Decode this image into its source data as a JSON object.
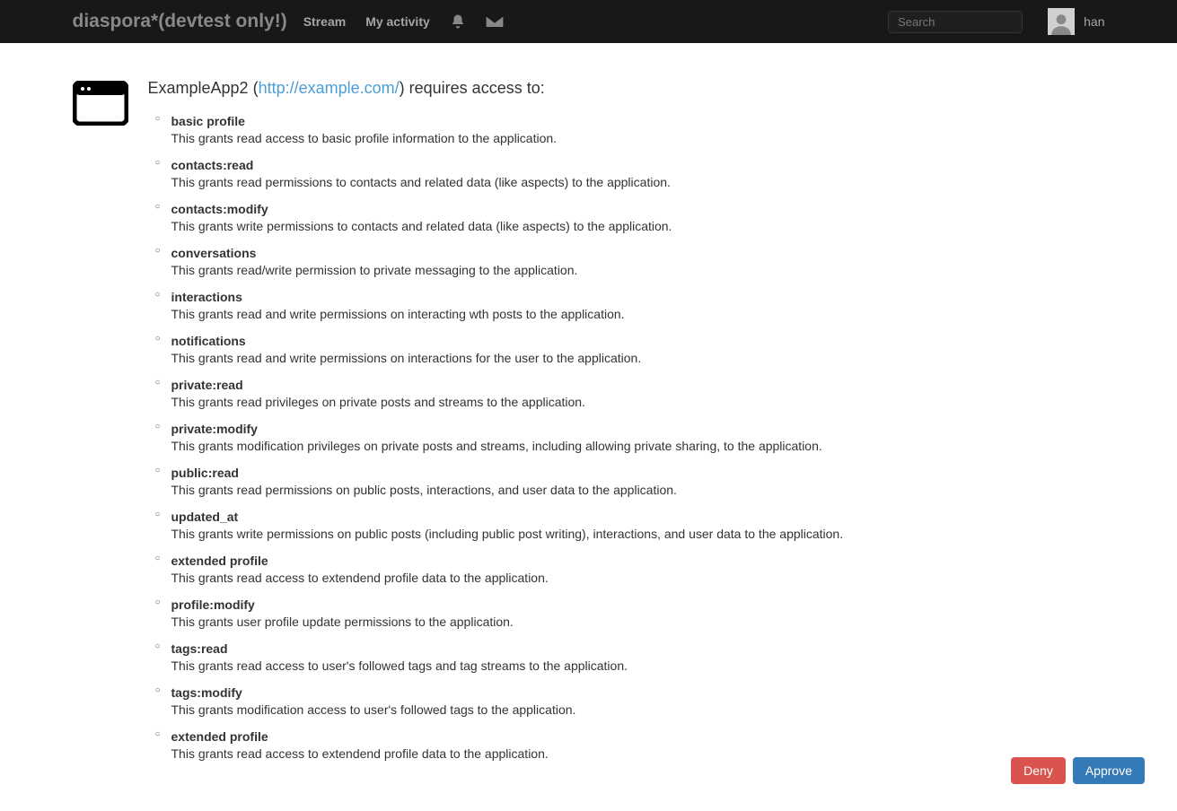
{
  "navbar": {
    "brand": "diaspora*(devtest only!)",
    "links": [
      "Stream",
      "My activity"
    ],
    "search_placeholder": "Search",
    "username": "han"
  },
  "auth": {
    "app_name": "ExampleApp2",
    "app_url": "http://example.com/",
    "heading_suffix": ") requires access to:",
    "heading_prefix_paren": " (",
    "scopes": [
      {
        "name": "basic profile",
        "desc": "This grants read access to basic profile information to the application."
      },
      {
        "name": "contacts:read",
        "desc": "This grants read permissions to contacts and related data (like aspects) to the application."
      },
      {
        "name": "contacts:modify",
        "desc": "This grants write permissions to contacts and related data (like aspects) to the application."
      },
      {
        "name": "conversations",
        "desc": "This grants read/write permission to private messaging to the application."
      },
      {
        "name": "interactions",
        "desc": "This grants read and write permissions on interacting wth posts to the application."
      },
      {
        "name": "notifications",
        "desc": "This grants read and write permissions on interactions for the user to the application."
      },
      {
        "name": "private:read",
        "desc": "This grants read privileges on private posts and streams to the application."
      },
      {
        "name": "private:modify",
        "desc": "This grants modification privileges on private posts and streams, including allowing private sharing, to the application."
      },
      {
        "name": "public:read",
        "desc": "This grants read permissions on public posts, interactions, and user data to the application."
      },
      {
        "name": "updated_at",
        "desc": "This grants write permissions on public posts (including public post writing), interactions, and user data to the application."
      },
      {
        "name": "extended profile",
        "desc": "This grants read access to extendend profile data to the application."
      },
      {
        "name": "profile:modify",
        "desc": "This grants user profile update permissions to the application."
      },
      {
        "name": "tags:read",
        "desc": "This grants read access to user's followed tags and tag streams to the application."
      },
      {
        "name": "tags:modify",
        "desc": "This grants modification access to user's followed tags to the application."
      },
      {
        "name": "extended profile",
        "desc": "This grants read access to extendend profile data to the application."
      }
    ]
  },
  "buttons": {
    "deny": "Deny",
    "approve": "Approve"
  }
}
